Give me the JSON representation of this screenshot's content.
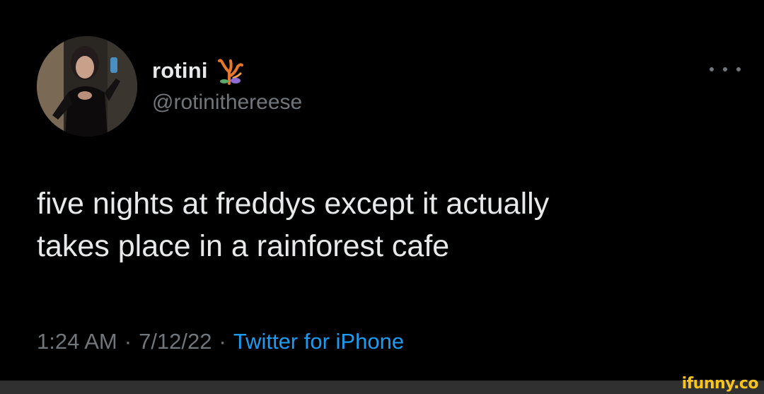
{
  "tweet": {
    "display_name": "rotini",
    "name_emoji": "coral-emoji",
    "handle": "@rotinithereese",
    "text": "five nights at freddys except it actually\ntakes place in a rainforest cafe",
    "time": "1:24 AM",
    "separator": "·",
    "date": "7/12/22",
    "source": "Twitter for iPhone"
  },
  "watermark": "ifunny.co",
  "colors": {
    "background": "#000000",
    "primary_text": "#e7e9ea",
    "secondary_text": "#71767b",
    "link": "#1d9bf0",
    "watermark": "#f8c41b",
    "footer_bar": "#303030"
  }
}
